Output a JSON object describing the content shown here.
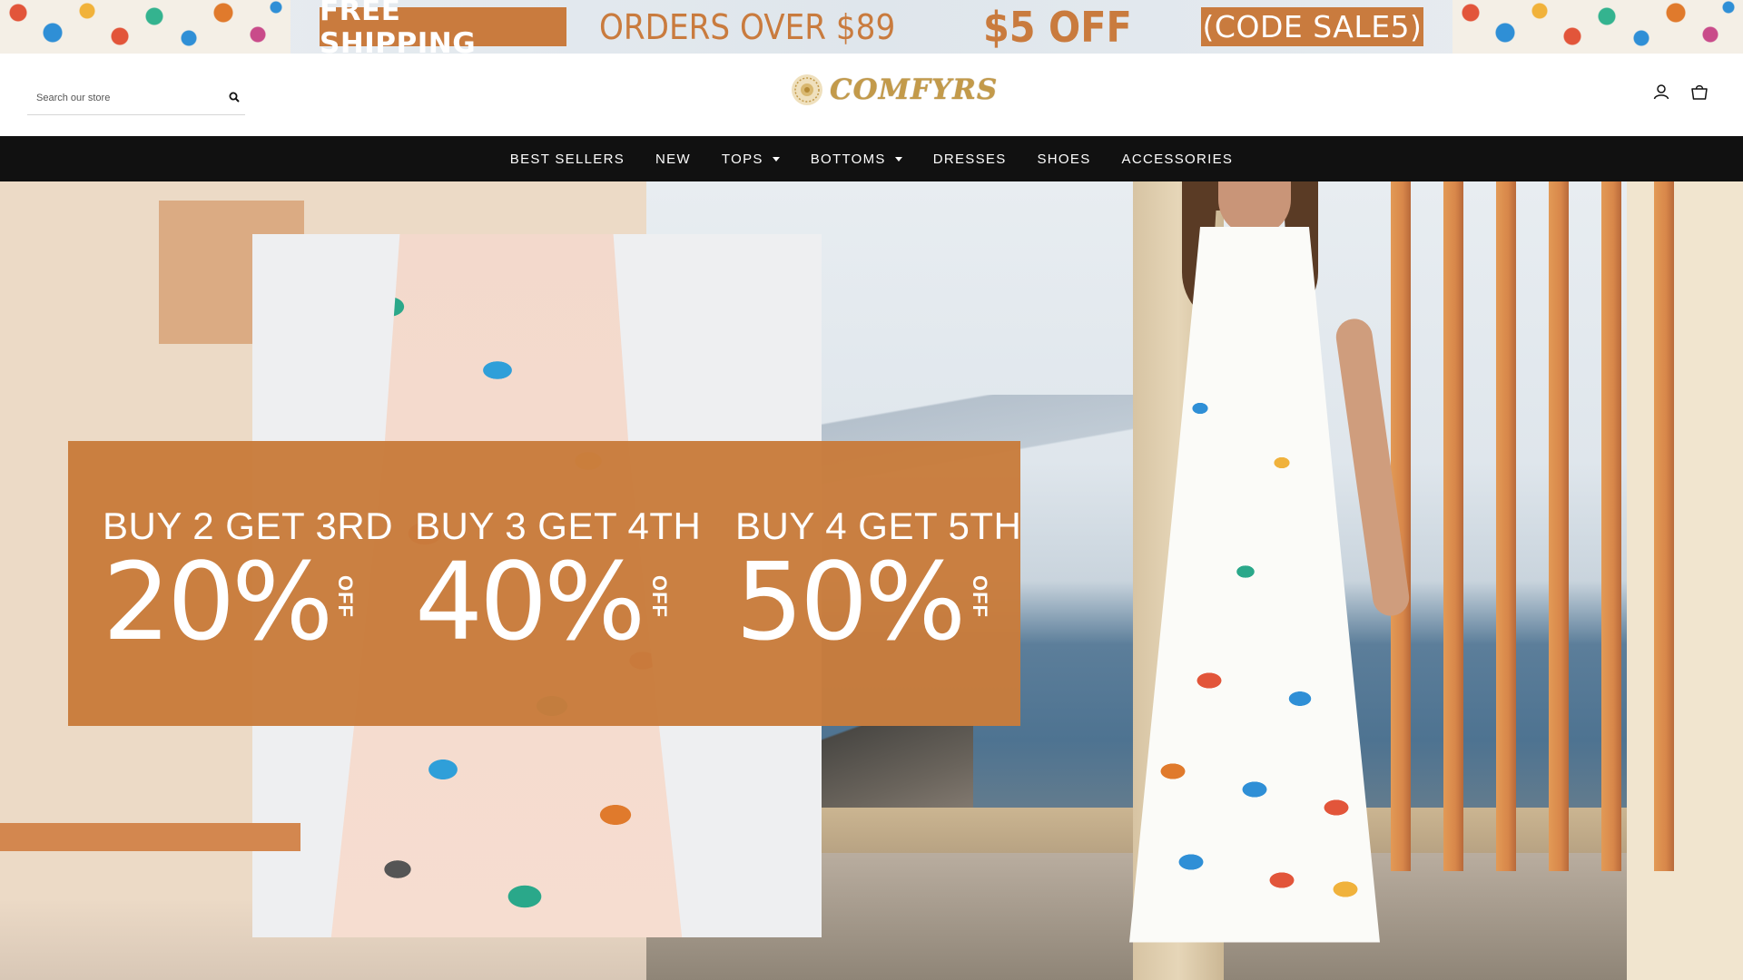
{
  "banner": {
    "shipping_label": "FREE SHIPPING",
    "orders_text": "ORDERS OVER $89",
    "discount_text": "$5 OFF",
    "code_text": "(CODE SALE5)",
    "accent_color": "#c97b3e"
  },
  "header": {
    "search": {
      "placeholder": "Search our store",
      "value": ""
    },
    "search_icon": "search-icon",
    "logo_text": "COMFYRS",
    "account_icon": "user-icon",
    "cart_icon": "shopping-bag-icon"
  },
  "nav": {
    "items": [
      {
        "label": "BEST SELLERS",
        "has_dropdown": false
      },
      {
        "label": "NEW",
        "has_dropdown": false
      },
      {
        "label": "TOPS",
        "has_dropdown": true
      },
      {
        "label": "BOTTOMS",
        "has_dropdown": true
      },
      {
        "label": "DRESSES",
        "has_dropdown": false
      },
      {
        "label": "SHOES",
        "has_dropdown": false
      },
      {
        "label": "ACCESSORIES",
        "has_dropdown": false
      }
    ]
  },
  "hero": {
    "offers": [
      {
        "line": "BUY 2 GET 3RD",
        "percent": "20%",
        "off": "OFF"
      },
      {
        "line": "BUY 3 GET 4TH",
        "percent": "40%",
        "off": "OFF"
      },
      {
        "line": "BUY 4 GET 5TH",
        "percent": "50%",
        "off": "OFF"
      }
    ],
    "panel_color": "#c87c3c"
  }
}
